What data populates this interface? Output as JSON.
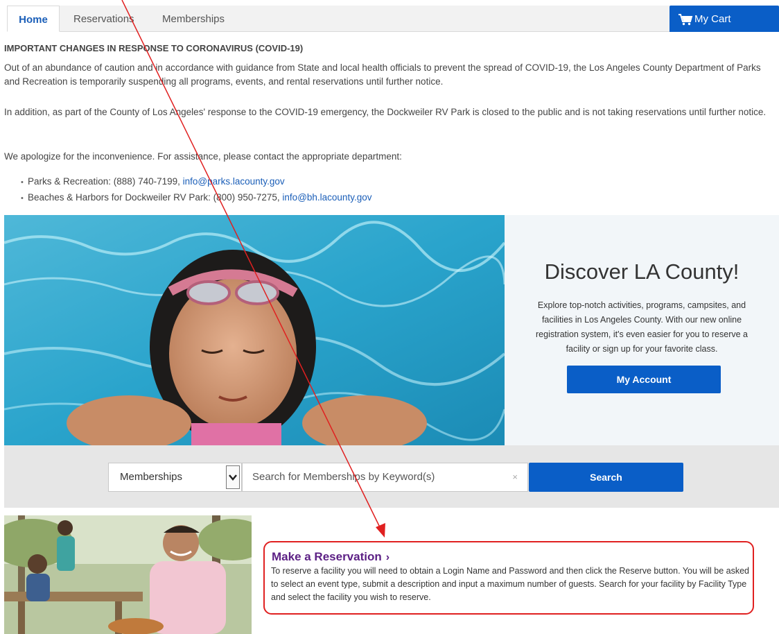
{
  "nav": {
    "tabs": [
      {
        "label": "Home",
        "active": true
      },
      {
        "label": "Reservations",
        "active": false
      },
      {
        "label": "Memberships",
        "active": false
      }
    ],
    "cart_label": "My Cart",
    "cart_icon": "shopping-cart-icon"
  },
  "notice": {
    "title": "IMPORTANT CHANGES IN RESPONSE TO CORONAVIRUS (COVID-19)",
    "paragraph1": "Out of an abundance of caution and in accordance with guidance from State and local health officials to prevent the spread of COVID-19, the Los Angeles County Department of Parks and Recreation is temporarily suspending all programs, events, and rental reservations until further notice.",
    "paragraph2": "In addition, as part of the County of Los Angeles' response to the COVID-19 emergency, the Dockweiler RV Park is closed to the public and is not taking reservations until further notice.",
    "paragraph3": "We apologize for the inconvenience. For assistance, please contact the appropriate department:",
    "contacts": [
      {
        "text": "Parks & Recreation: (888) 740-7199, ",
        "email": "info@parks.lacounty.gov"
      },
      {
        "text": "Beaches & Harbors for Dockweiler RV Park: (800) 950-7275, ",
        "email": "info@bh.lacounty.gov"
      }
    ]
  },
  "hero": {
    "title": "Discover LA County!",
    "description": "Explore top-notch activities, programs, campsites, and facilities in Los Angeles County. With our new online registration system, it's even easier for you to reserve a facility or sign up for your favorite class.",
    "account_button": "My Account"
  },
  "search": {
    "category_selected": "Memberships",
    "placeholder": "Search for Memberships by Keyword(s)",
    "clear_glyph": "×",
    "button_label": "Search"
  },
  "reservation": {
    "title": "Make a Reservation",
    "chevron": "›",
    "description": "To reserve a facility you will need to obtain a Login Name and Password and then click the Reserve button. You will be asked to select an event type, submit a description and input a maximum number of guests. Search for your facility by Facility Type and select the facility you wish to reserve."
  },
  "colors": {
    "primary_blue": "#0a5ec7",
    "link_blue": "#1a5eb8",
    "purple_heading": "#5b1f84",
    "annotation_red": "#e02020"
  }
}
